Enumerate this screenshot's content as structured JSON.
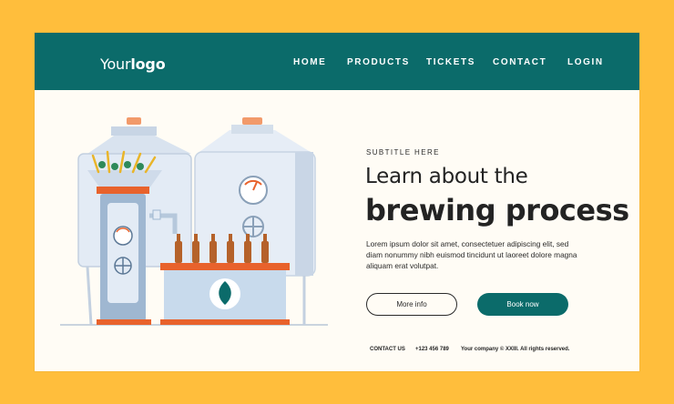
{
  "header": {
    "logo_light": "Your",
    "logo_bold": "logo",
    "nav": [
      "HOME",
      "PRODUCTS",
      "TICKETS",
      "CONTACT"
    ],
    "login": "LOGIN"
  },
  "hero": {
    "subtitle": "SUBTITLE HERE",
    "title_line1": "Learn about the",
    "title_line2": "brewing process",
    "body": "Lorem ipsum dolor sit amet, consectetuer adipiscing elit, sed diam nonummy nibh euismod tincidunt ut laoreet dolore magna aliquam erat volutpat.",
    "more_info": "More info",
    "book_now": "Book now"
  },
  "footer": {
    "contact": "CONTACT US",
    "phone": "+123 456 789",
    "rights": "Your company © XXIII. All rights reserved."
  },
  "colors": {
    "background": "#ffbe3c",
    "brand": "#0b6b6a",
    "accent": "#e8622c",
    "tank": "#d9e3ef"
  }
}
